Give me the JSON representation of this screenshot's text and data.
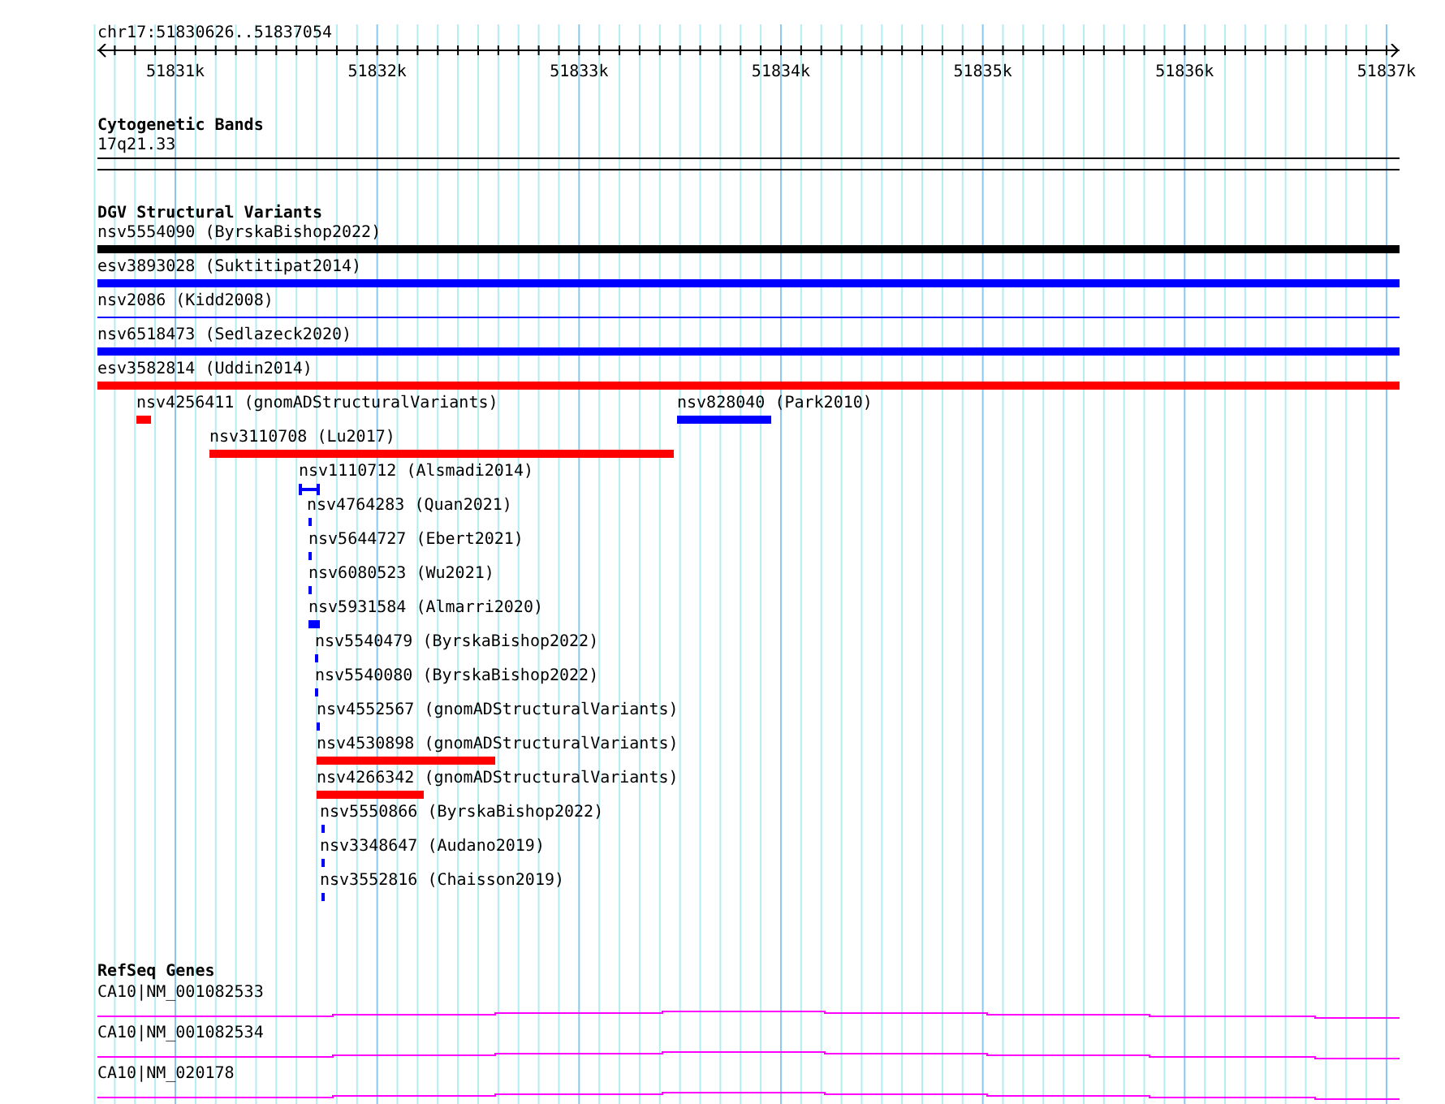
{
  "ruler": {
    "location": "chr17:51830626..51837054",
    "ticks": [
      "51831k",
      "51832k",
      "51833k",
      "51834k",
      "51835k",
      "51836k",
      "51837k"
    ]
  },
  "tracks": [
    {
      "kind": "cytoband",
      "title": "Cytogenetic Bands",
      "features": [
        {
          "label": "17q21.33"
        }
      ]
    },
    {
      "kind": "variants",
      "title": "DGV Structural Variants",
      "features": [
        {
          "label": "nsv5554090 (ByrskaBishop2022)",
          "color": "#000000",
          "kind": "bar"
        },
        {
          "label": "esv3893028 (Suktitipat2014)",
          "color": "#0000ff",
          "kind": "bar"
        },
        {
          "label": "nsv2086 (Kidd2008)",
          "color": "#0000ff",
          "kind": "line"
        },
        {
          "label": "nsv6518473 (Sedlazeck2020)",
          "color": "#0000ff",
          "kind": "bar"
        },
        {
          "label": "esv3582814 (Uddin2014)",
          "color": "#ff0000",
          "kind": "bar"
        },
        {
          "label": "nsv4256411 (gnomADStructuralVariants)",
          "color": "#ff0000",
          "kind": "bar"
        },
        {
          "label": "nsv828040 (Park2010)",
          "color": "#0000ff",
          "kind": "bar"
        },
        {
          "label": "nsv3110708 (Lu2017)",
          "color": "#ff0000",
          "kind": "bar"
        },
        {
          "label": "nsv1110712 (Alsmadi2014)",
          "color": "#0000ff",
          "kind": "bracket"
        },
        {
          "label": "nsv4764283 (Quan2021)",
          "color": "#0000ff",
          "kind": "bar"
        },
        {
          "label": "nsv5644727 (Ebert2021)",
          "color": "#0000ff",
          "kind": "bar"
        },
        {
          "label": "nsv6080523 (Wu2021)",
          "color": "#0000ff",
          "kind": "bar"
        },
        {
          "label": "nsv5931584 (Almarri2020)",
          "color": "#0000ff",
          "kind": "bar"
        },
        {
          "label": "nsv5540479 (ByrskaBishop2022)",
          "color": "#0000ff",
          "kind": "bar"
        },
        {
          "label": "nsv5540080 (ByrskaBishop2022)",
          "color": "#0000ff",
          "kind": "bar"
        },
        {
          "label": "nsv4552567 (gnomADStructuralVariants)",
          "color": "#0000ff",
          "kind": "bar"
        },
        {
          "label": "nsv4530898 (gnomADStructuralVariants)",
          "color": "#ff0000",
          "kind": "bar"
        },
        {
          "label": "nsv4266342 (gnomADStructuralVariants)",
          "color": "#ff0000",
          "kind": "bar"
        },
        {
          "label": "nsv5550866 (ByrskaBishop2022)",
          "color": "#0000ff",
          "kind": "bar"
        },
        {
          "label": "nsv3348647 (Audano2019)",
          "color": "#0000ff",
          "kind": "bar"
        },
        {
          "label": "nsv3552816 (Chaisson2019)",
          "color": "#0000ff",
          "kind": "bar"
        }
      ]
    },
    {
      "kind": "genes",
      "title": "RefSeq Genes",
      "features": [
        {
          "label": "CA10|NM_001082533"
        },
        {
          "label": "CA10|NM_001082534"
        },
        {
          "label": "CA10|NM_020178"
        }
      ]
    }
  ]
}
